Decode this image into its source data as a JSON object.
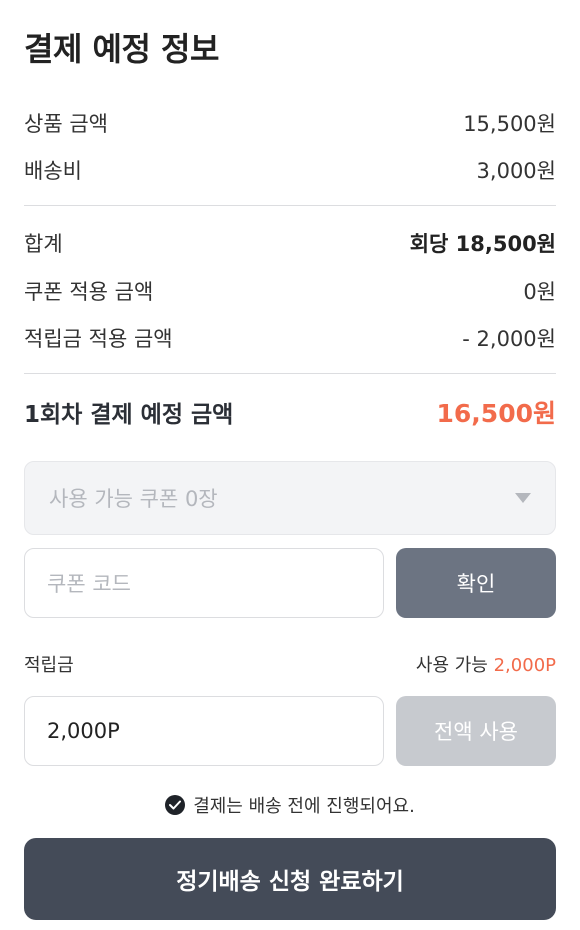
{
  "title": "결제 예정 정보",
  "summary": {
    "product_label": "상품 금액",
    "product_value": "15,500원",
    "shipping_label": "배송비",
    "shipping_value": "3,000원",
    "sum_label": "합계",
    "sum_value": "회당 18,500원",
    "coupon_label": "쿠폰 적용 금액",
    "coupon_value": "0원",
    "points_label": "적립금 적용 금액",
    "points_value": "- 2,000원"
  },
  "total": {
    "label": "1회차 결제 예정 금액",
    "value": "16,500원"
  },
  "coupon_select": {
    "placeholder": "사용 가능 쿠폰 0장"
  },
  "coupon_code": {
    "placeholder": "쿠폰 코드",
    "confirm_label": "확인"
  },
  "points": {
    "label": "적립금",
    "available_label": "사용 가능",
    "available_amount": "2,000P",
    "input_value": "2,000P",
    "use_all_label": "전액 사용"
  },
  "notice": "결제는 배송 전에 진행되어요.",
  "submit_label": "정기배송 신청 완료하기",
  "colors": {
    "accent": "#f26b4b",
    "submit_bg": "#444b58",
    "confirm_bg": "#6c7482",
    "disabled_bg": "#c7cacf"
  }
}
